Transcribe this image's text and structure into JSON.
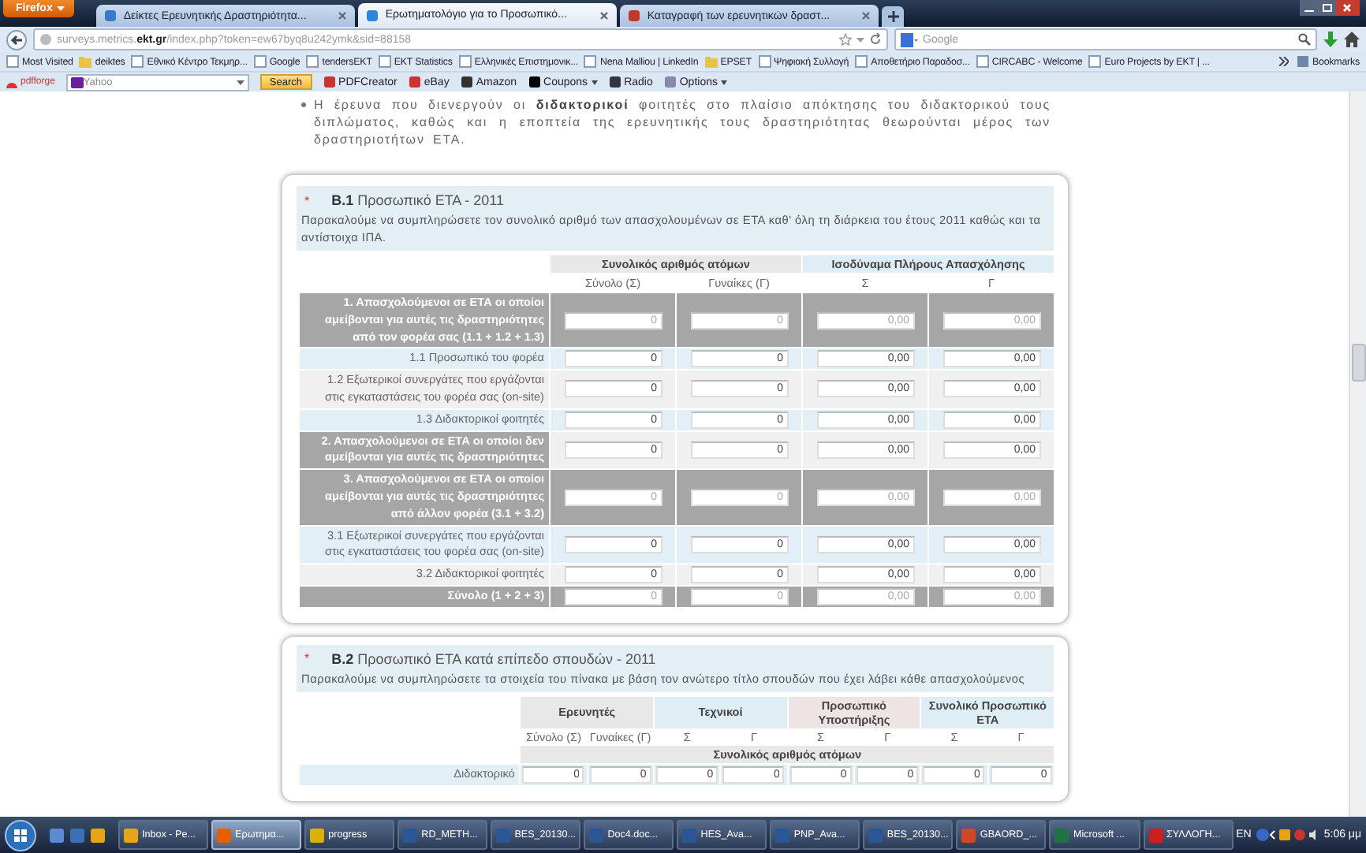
{
  "browser": {
    "menu_button": "Firefox",
    "tabs": [
      {
        "title": "Δείκτες Ερευνητικής Δραστηριότητα...",
        "selected": false
      },
      {
        "title": "Ερωτηματολόγιο για το Προσωπικό...",
        "selected": true
      },
      {
        "title": "Καταγραφή των ερευνητικών δραστ...",
        "selected": false
      }
    ],
    "url": "surveys.metrics.**ekt.gr**/index.php?token=ew67byq8u242ymk&sid=88158",
    "search_placeholder": "Google",
    "bookmarks": [
      "Most Visited",
      "deiktes",
      "Εθνικό Κέντρο Τεκμηρ...",
      "Google",
      "tendersEKT",
      "EKT Statistics",
      "Ελληνικές Επιστημονικ...",
      "Nena Malliou | LinkedIn",
      "EPSET",
      "Ψηφιακή Συλλογή",
      "Αποθετήριο Παραδοσ...",
      "CIRCABC - Welcome",
      "Euro Projects by EKT | ..."
    ],
    "bookmarks_menu": "Bookmarks",
    "toolbar": {
      "brand": "pdfforge",
      "search_placeholder": "Yahoo",
      "search_button": "Search",
      "items": [
        {
          "label": "PDFCreator",
          "dropdown": false
        },
        {
          "label": "eBay",
          "dropdown": false
        },
        {
          "label": "Amazon",
          "dropdown": false
        },
        {
          "label": "Coupons",
          "dropdown": true
        },
        {
          "label": "Radio",
          "dropdown": false
        },
        {
          "label": "Options",
          "dropdown": true
        }
      ]
    }
  },
  "page": {
    "intro": "Η έρευνα που διενεργούν οι **διδακτορικοί** φοιτητές στο πλαίσιο απόκτησης του διδακτορικού τους διπλώματος, καθώς και η εποπτεία της ερευνητικής τους δραστηριότητας θεωρούνται μέρος των δραστηριοτήτων ΕΤΑ.",
    "section_b1": {
      "required_mark": "*",
      "number": "B.1",
      "title": "Προσωπικό ΕΤΑ - 2011",
      "description": "Παρακαλούμε να συμπληρώσετε τον συνολικό αριθμό των απασχολουμένων σε ΕΤΑ καθ' όλη τη διάρκεια του έτους 2011 καθώς και τα αντίστοιχα ΙΠΑ.",
      "column_groups": [
        "Συνολικός αριθμός ατόμων",
        "Ισοδύναμα Πλήρους Απασχόλησης"
      ],
      "columns": [
        "Σύνολο (Σ)",
        "Γυναίκες (Γ)",
        "Σ",
        "Γ"
      ],
      "rows": [
        {
          "kind": "total",
          "label": "1. Απασχολούμενοι σε ΕΤΑ οι οποίοι αμείβονται για αυτές τις δραστηριότητες από τον φορέα σας (1.1 + 1.2 + 1.3)",
          "values": [
            "0",
            "0",
            "0,00",
            "0,00"
          ]
        },
        {
          "kind": "item",
          "label": "1.1 Προσωπικό του φορέα",
          "values": [
            "0",
            "0",
            "0,00",
            "0,00"
          ]
        },
        {
          "kind": "item",
          "label": "1.2 Εξωτερικοί συνεργάτες που εργάζονται στις εγκαταστάσεις του φορέα σας (on-site)",
          "values": [
            "0",
            "0",
            "0,00",
            "0,00"
          ]
        },
        {
          "kind": "item",
          "label": "1.3 Διδακτορικοί φοιτητές",
          "values": [
            "0",
            "0",
            "0,00",
            "0,00"
          ]
        },
        {
          "kind": "heading",
          "label": "2. Απασχολούμενοι σε ΕΤΑ οι οποίοι δεν αμείβονται για αυτές τις δραστηριότητες",
          "values": [
            "0",
            "0",
            "0,00",
            "0,00"
          ]
        },
        {
          "kind": "total",
          "label": "3. Απασχολούμενοι σε ΕΤΑ οι οποίοι αμείβονται για αυτές τις δραστηριότητες από άλλον φορέα (3.1 + 3.2)",
          "values": [
            "0",
            "0",
            "0,00",
            "0,00"
          ]
        },
        {
          "kind": "item",
          "label": "3.1 Εξωτερικοί συνεργάτες που εργάζονται στις εγκαταστάσεις του φορέα σας (on-site)",
          "values": [
            "0",
            "0",
            "0,00",
            "0,00"
          ]
        },
        {
          "kind": "item",
          "label": "3.2 Διδακτορικοί φοιτητές",
          "values": [
            "0",
            "0",
            "0,00",
            "0,00"
          ]
        },
        {
          "kind": "total",
          "label": "Σύνολο (1 + 2 + 3)",
          "values": [
            "0",
            "0",
            "0,00",
            "0,00"
          ]
        }
      ]
    },
    "section_b2": {
      "required_mark": "*",
      "number": "B.2",
      "title": "Προσωπικό ΕΤΑ κατά επίπεδο σπουδών - 2011",
      "description": "Παρακαλούμε να συμπληρώσετε τα στοιχεία του πίνακα με βάση τον ανώτερο τίτλο σπουδών που έχει λάβει κάθε απασχολούμενος",
      "column_groups": [
        "Ερευνητές",
        "Τεχνικοί",
        "Προσωπικό Υποστήριξης",
        "Συνολικό Προσωπικό ΕΤΑ"
      ],
      "columns": [
        "Σύνολο (Σ)",
        "Γυναίκες (Γ)",
        "Σ",
        "Γ",
        "Σ",
        "Γ",
        "Σ",
        "Γ"
      ],
      "band": "Συνολικός αριθμός ατόμων",
      "rows": [
        {
          "label": "Διδακτορικό",
          "values": [
            "0",
            "0",
            "0",
            "0",
            "0",
            "0",
            "0",
            "0"
          ]
        }
      ]
    }
  },
  "taskbar": {
    "items": [
      {
        "kind": "outlook",
        "label": "Inbox - Pe...",
        "selected": false
      },
      {
        "kind": "firefox",
        "label": "Ερωτημα...",
        "selected": true
      },
      {
        "kind": "folder",
        "label": "progress",
        "selected": false
      },
      {
        "kind": "word",
        "label": "RD_METH...",
        "selected": false
      },
      {
        "kind": "word",
        "label": "BES_20130...",
        "selected": false
      },
      {
        "kind": "word",
        "label": "Doc4.doc...",
        "selected": false
      },
      {
        "kind": "word",
        "label": "HES_Ava...",
        "selected": false
      },
      {
        "kind": "word",
        "label": "PNP_Ava...",
        "selected": false
      },
      {
        "kind": "word",
        "label": "BES_20130...",
        "selected": false
      },
      {
        "kind": "powerpoint",
        "label": "GBAORD_...",
        "selected": false
      },
      {
        "kind": "excel",
        "label": "Microsoft ...",
        "selected": false
      },
      {
        "kind": "pdf",
        "label": "ΣΥΛΛΟΓΗ...",
        "selected": false
      }
    ],
    "language": "EN",
    "clock": "5:06 μμ"
  }
}
